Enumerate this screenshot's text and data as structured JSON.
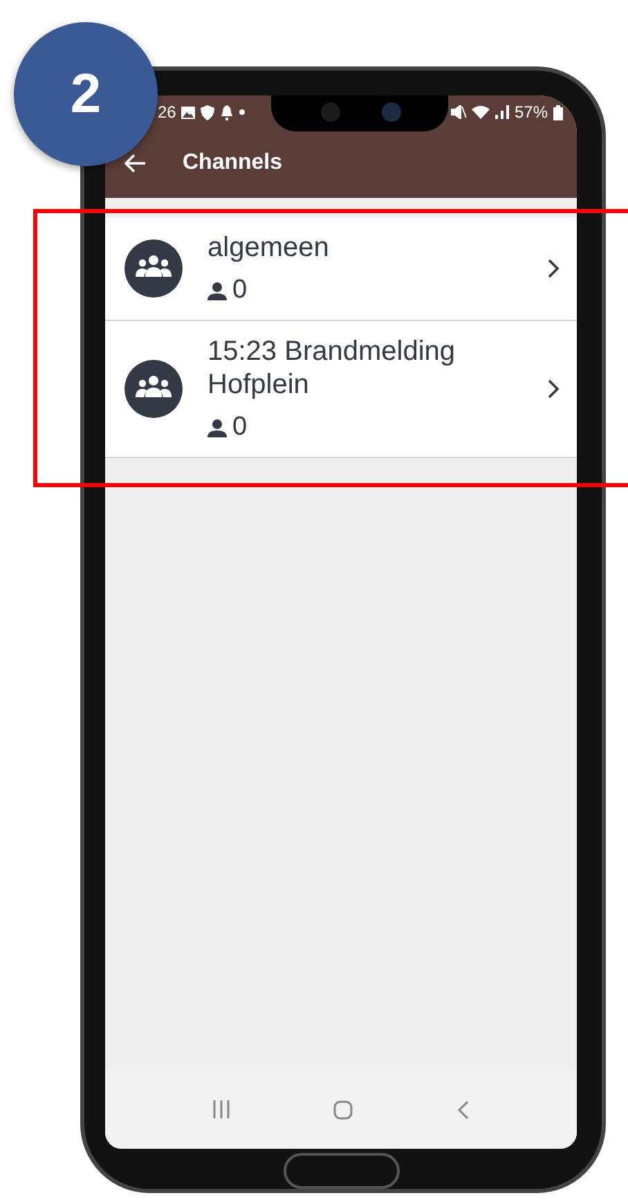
{
  "step_badge": "2",
  "status_bar": {
    "time": "26",
    "battery": "57%"
  },
  "app_bar": {
    "title": "Channels"
  },
  "channels": [
    {
      "name": "algemeen",
      "members": "0"
    },
    {
      "name": "15:23 Brandmelding Hofplein",
      "members": "0"
    }
  ]
}
